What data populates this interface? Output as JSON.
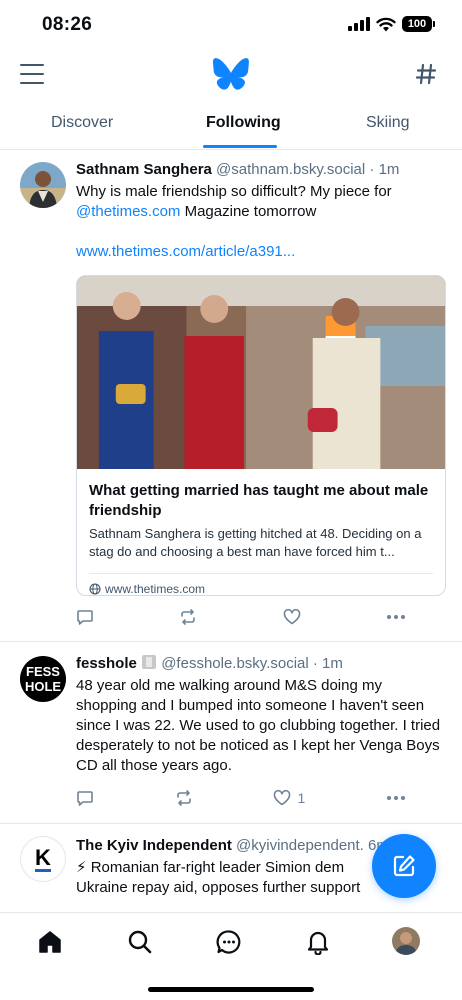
{
  "status": {
    "time": "08:26",
    "battery": "100"
  },
  "tabs": [
    {
      "label": "Discover"
    },
    {
      "label": "Following"
    },
    {
      "label": "Skiing"
    }
  ],
  "posts": [
    {
      "author": "Sathnam Sanghera",
      "handle": "@sathnam.bsky.social",
      "time": "· 1m",
      "text_before": "Why is male friendship so difficult? My piece for",
      "mention": "@thetimes.com",
      "text_after": "Magazine tomorrow",
      "link": "www.thetimes.com/article/a391...",
      "embed": {
        "title": "What getting married has taught me about male friendship",
        "description": "Sathnam Sanghera is getting hitched at 48. Deciding on a stag do and choosing a best man have forced him t...",
        "domain": "www.thetimes.com"
      },
      "likes": ""
    },
    {
      "author": "fesshole",
      "avatar_text_1": "FESS",
      "avatar_text_2": "HOLE",
      "handle": "@fesshole.bsky.social",
      "time": "· 1m",
      "text": "48 year old me walking around M&S doing my shopping and I bumped into someone I haven't seen since I was 22. We used to go clubbing together. I tried desperately to not be noticed as I kept her Venga Boys CD all those years ago.",
      "likes": "1"
    },
    {
      "author": "The Kyiv Independent",
      "avatar_text": "K",
      "handle": "@kyivindependent.",
      "time": "6m",
      "text_line1": "⚡ Romanian far-right leader Simion dem",
      "text_line2": "Ukraine repay aid, opposes further support"
    }
  ],
  "icons": {
    "menu": "hamburger-icon",
    "logo": "butterfly-logo",
    "feeds": "hashtag-icon",
    "compose": "compose-icon",
    "nav": [
      "home-icon",
      "search-icon",
      "chat-icon",
      "bell-icon",
      "profile-avatar"
    ]
  },
  "colors": {
    "accent": "#1083fe",
    "text": "#0b0f14",
    "muted": "#42576c"
  }
}
